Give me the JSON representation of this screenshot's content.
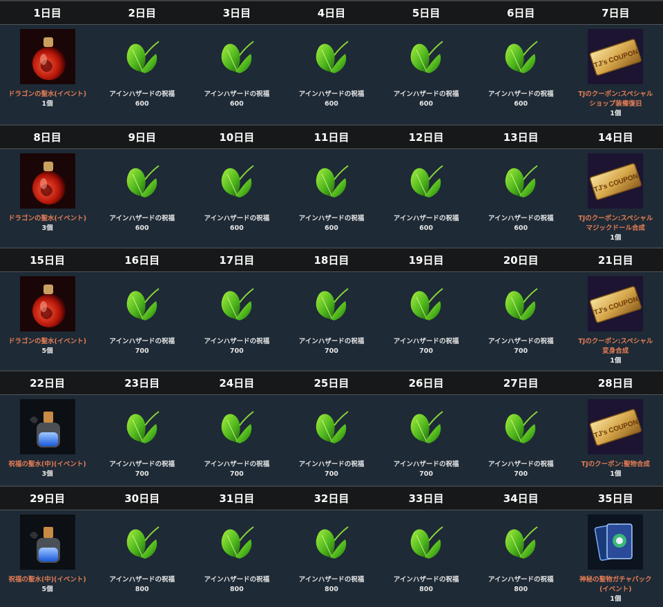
{
  "weeks": [
    {
      "days": [
        {
          "day": "1日目",
          "item": "ドラゴンの聖水(イベント)",
          "qty": "1個",
          "icon": "dragon-holy-water-icon",
          "color": "orange"
        },
        {
          "day": "2日目",
          "item": "アインハザードの祝福",
          "qty": "600",
          "icon": "leaf-icon",
          "color": "white"
        },
        {
          "day": "3日目",
          "item": "アインハザードの祝福",
          "qty": "600",
          "icon": "leaf-icon",
          "color": "white"
        },
        {
          "day": "4日目",
          "item": "アインハザードの祝福",
          "qty": "600",
          "icon": "leaf-icon",
          "color": "white"
        },
        {
          "day": "5日目",
          "item": "アインハザードの祝福",
          "qty": "600",
          "icon": "leaf-icon",
          "color": "white"
        },
        {
          "day": "6日目",
          "item": "アインハザードの祝福",
          "qty": "600",
          "icon": "leaf-icon",
          "color": "white"
        },
        {
          "day": "7日目",
          "item": "TJのクーポン:スペシャルショップ装備復旧",
          "qty": "1個",
          "icon": "coupon-icon",
          "color": "orange",
          "lines": [
            "TJのクーポン:スペシャル",
            "ショップ装備復旧"
          ]
        }
      ]
    },
    {
      "days": [
        {
          "day": "8日目",
          "item": "ドラゴンの聖水(イベント)",
          "qty": "3個",
          "icon": "dragon-holy-water-icon",
          "color": "orange"
        },
        {
          "day": "9日目",
          "item": "アインハザードの祝福",
          "qty": "600",
          "icon": "leaf-icon",
          "color": "white"
        },
        {
          "day": "10日目",
          "item": "アインハザードの祝福",
          "qty": "600",
          "icon": "leaf-icon",
          "color": "white"
        },
        {
          "day": "11日目",
          "item": "アインハザードの祝福",
          "qty": "600",
          "icon": "leaf-icon",
          "color": "white"
        },
        {
          "day": "12日目",
          "item": "アインハザードの祝福",
          "qty": "600",
          "icon": "leaf-icon",
          "color": "white"
        },
        {
          "day": "13日目",
          "item": "アインハザードの祝福",
          "qty": "600",
          "icon": "leaf-icon",
          "color": "white"
        },
        {
          "day": "14日目",
          "item": "TJのクーポン:スペシャルマジックドール合成",
          "qty": "1個",
          "icon": "coupon-icon",
          "color": "orange",
          "lines": [
            "TJのクーポン:スペシャル",
            "マジックドール合成"
          ]
        }
      ]
    },
    {
      "days": [
        {
          "day": "15日目",
          "item": "ドラゴンの聖水(イベント)",
          "qty": "5個",
          "icon": "dragon-holy-water-icon",
          "color": "orange"
        },
        {
          "day": "16日目",
          "item": "アインハザードの祝福",
          "qty": "700",
          "icon": "leaf-icon",
          "color": "white"
        },
        {
          "day": "17日目",
          "item": "アインハザードの祝福",
          "qty": "700",
          "icon": "leaf-icon",
          "color": "white"
        },
        {
          "day": "18日目",
          "item": "アインハザードの祝福",
          "qty": "700",
          "icon": "leaf-icon",
          "color": "white"
        },
        {
          "day": "19日目",
          "item": "アインハザードの祝福",
          "qty": "700",
          "icon": "leaf-icon",
          "color": "white"
        },
        {
          "day": "20日目",
          "item": "アインハザードの祝福",
          "qty": "700",
          "icon": "leaf-icon",
          "color": "white"
        },
        {
          "day": "21日目",
          "item": "TJのクーポン:スペシャル変身合成",
          "qty": "1個",
          "icon": "coupon-icon",
          "color": "orange",
          "lines": [
            "TJのクーポン:スペシャル",
            "変身合成"
          ]
        }
      ]
    },
    {
      "days": [
        {
          "day": "22日目",
          "item": "祝福の聖水(中)(イベント)",
          "qty": "3個",
          "icon": "blessed-holy-water-icon",
          "color": "orange"
        },
        {
          "day": "23日目",
          "item": "アインハザードの祝福",
          "qty": "700",
          "icon": "leaf-icon",
          "color": "white"
        },
        {
          "day": "24日目",
          "item": "アインハザードの祝福",
          "qty": "700",
          "icon": "leaf-icon",
          "color": "white"
        },
        {
          "day": "25日目",
          "item": "アインハザードの祝福",
          "qty": "700",
          "icon": "leaf-icon",
          "color": "white"
        },
        {
          "day": "26日目",
          "item": "アインハザードの祝福",
          "qty": "700",
          "icon": "leaf-icon",
          "color": "white"
        },
        {
          "day": "27日目",
          "item": "アインハザードの祝福",
          "qty": "700",
          "icon": "leaf-icon",
          "color": "white"
        },
        {
          "day": "28日目",
          "item": "TJのクーポン:聖物合成",
          "qty": "1個",
          "icon": "coupon-icon",
          "color": "orange"
        }
      ]
    },
    {
      "days": [
        {
          "day": "29日目",
          "item": "祝福の聖水(中)(イベント)",
          "qty": "5個",
          "icon": "blessed-holy-water-icon",
          "color": "orange"
        },
        {
          "day": "30日目",
          "item": "アインハザードの祝福",
          "qty": "800",
          "icon": "leaf-icon",
          "color": "white"
        },
        {
          "day": "31日目",
          "item": "アインハザードの祝福",
          "qty": "800",
          "icon": "leaf-icon",
          "color": "white"
        },
        {
          "day": "32日目",
          "item": "アインハザードの祝福",
          "qty": "800",
          "icon": "leaf-icon",
          "color": "white"
        },
        {
          "day": "33日目",
          "item": "アインハザードの祝福",
          "qty": "800",
          "icon": "leaf-icon",
          "color": "white"
        },
        {
          "day": "34日目",
          "item": "アインハザードの祝福",
          "qty": "800",
          "icon": "leaf-icon",
          "color": "white"
        },
        {
          "day": "35日目",
          "item": "神秘の聖物ガチャパック(イベント)",
          "qty": "1個",
          "icon": "card-pack-icon",
          "color": "orange",
          "lines": [
            "神秘の聖物ガチャパック",
            "(イベント)"
          ]
        }
      ]
    }
  ],
  "colors": {
    "header_bg": "#171819",
    "body_bg": "#1e2a36",
    "item_orange": "#e47d55",
    "item_white": "#e6e6e6"
  }
}
